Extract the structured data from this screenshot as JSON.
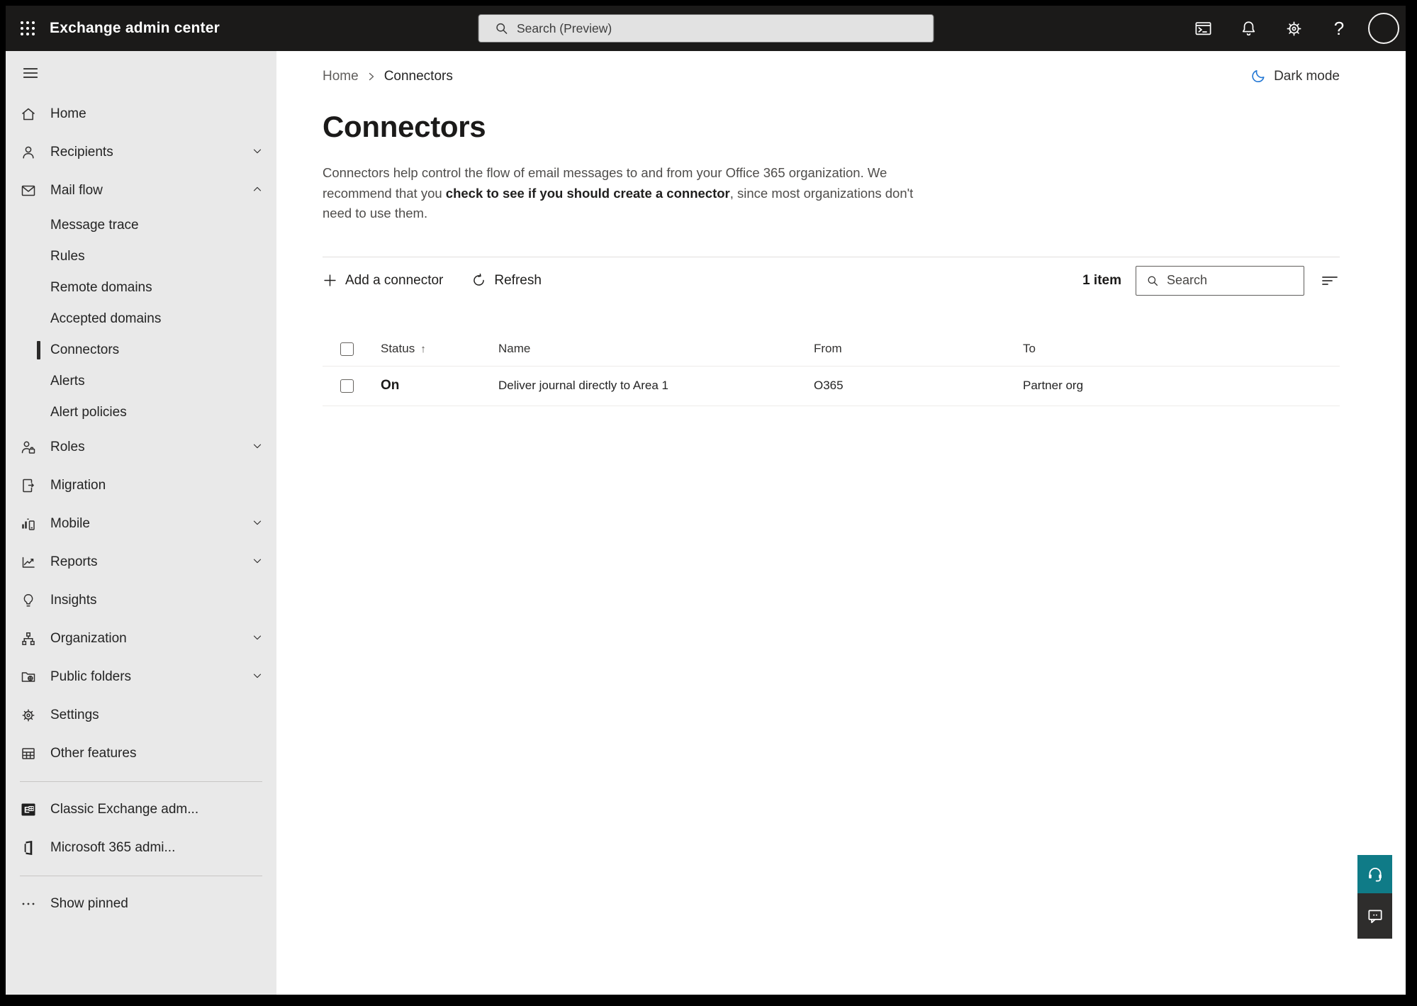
{
  "topbar": {
    "app_title": "Exchange admin center",
    "search_placeholder": "Search (Preview)",
    "help_glyph": "?"
  },
  "sidebar": {
    "items": [
      {
        "label": "Home"
      },
      {
        "label": "Recipients"
      },
      {
        "label": "Mail flow"
      },
      {
        "label": "Message trace"
      },
      {
        "label": "Rules"
      },
      {
        "label": "Remote domains"
      },
      {
        "label": "Accepted domains"
      },
      {
        "label": "Connectors",
        "selected": true
      },
      {
        "label": "Alerts"
      },
      {
        "label": "Alert policies"
      },
      {
        "label": "Roles"
      },
      {
        "label": "Migration"
      },
      {
        "label": "Mobile"
      },
      {
        "label": "Reports"
      },
      {
        "label": "Insights"
      },
      {
        "label": "Organization"
      },
      {
        "label": "Public folders"
      },
      {
        "label": "Settings"
      },
      {
        "label": "Other features"
      },
      {
        "label": "Classic Exchange adm..."
      },
      {
        "label": "Microsoft 365 admi..."
      },
      {
        "label": "Show pinned"
      }
    ]
  },
  "content_header": {
    "breadcrumb_root": "Home",
    "breadcrumb_current": "Connectors",
    "dark_mode_label": "Dark mode",
    "title": "Connectors",
    "description_before": "Connectors help control the flow of email messages to and from your Office 365 organization. We recommend that you ",
    "description_emphasis": "check to see if you should create a connector",
    "description_after": ", since most organizations don't need to use them."
  },
  "toolbar": {
    "add_label": "Add a connector",
    "refresh_label": "Refresh",
    "item_count": "1 item",
    "search_placeholder": "Search"
  },
  "table": {
    "columns": {
      "status": "Status",
      "name": "Name",
      "from": "From",
      "to": "To"
    },
    "sort_indicator": "↑",
    "rows": [
      {
        "status": "On",
        "name": "Deliver journal directly to Area 1",
        "from": "O365",
        "to": "Partner org"
      }
    ]
  },
  "colors": {
    "topbar_bg": "#1b1a19",
    "sidebar_bg": "#e9e9e9",
    "accent_blue": "#2478d4",
    "support_teal": "#0f7b87",
    "feedback_dark": "#2e2d2c",
    "selected_indicator": "#2b2a29"
  }
}
